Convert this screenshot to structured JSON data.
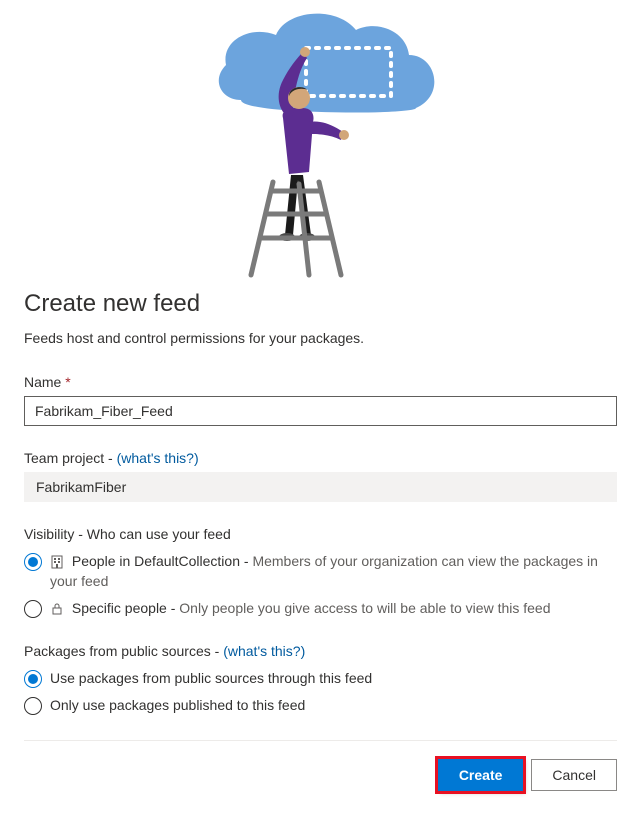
{
  "page": {
    "title": "Create new feed",
    "subtitle": "Feeds host and control permissions for your packages."
  },
  "name": {
    "label": "Name",
    "required_marker": "*",
    "value": "Fabrikam_Fiber_Feed"
  },
  "team_project": {
    "label": "Team project -",
    "help_link": "(what's this?)",
    "value": "FabrikamFiber"
  },
  "visibility": {
    "label": "Visibility - Who can use your feed",
    "options": [
      {
        "title": "People in DefaultCollection -",
        "desc": "Members of your organization can view the packages in your feed",
        "selected": true,
        "icon": "org"
      },
      {
        "title": "Specific people -",
        "desc": "Only people you give access to will be able to view this feed",
        "selected": false,
        "icon": "lock"
      }
    ]
  },
  "public_sources": {
    "label": "Packages from public sources -",
    "help_link": "(what's this?)",
    "options": [
      {
        "title": "Use packages from public sources through this feed",
        "selected": true
      },
      {
        "title": "Only use packages published to this feed",
        "selected": false
      }
    ]
  },
  "buttons": {
    "create": "Create",
    "cancel": "Cancel"
  }
}
